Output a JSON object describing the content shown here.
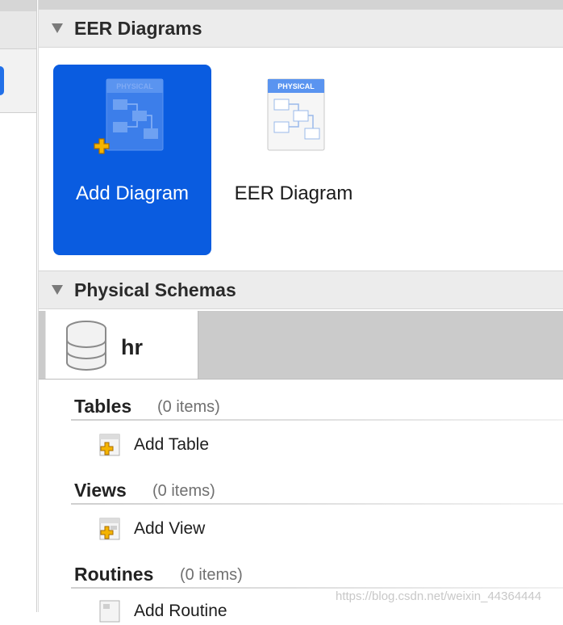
{
  "eer_section": {
    "title": "EER Diagrams"
  },
  "diagram_tiles": [
    {
      "label": "Add Diagram",
      "badge": "PHYSICAL",
      "selected": true
    },
    {
      "label": "EER Diagram",
      "badge": "PHYSICAL",
      "selected": false
    }
  ],
  "physical_section": {
    "title": "Physical Schemas"
  },
  "schema_tab": {
    "name": "hr"
  },
  "groups": [
    {
      "title": "Tables",
      "count": "(0 items)",
      "add_label": "Add Table"
    },
    {
      "title": "Views",
      "count": "(0 items)",
      "add_label": "Add View"
    },
    {
      "title": "Routines",
      "count": "(0 items)",
      "add_label": "Add Routine"
    }
  ],
  "watermark": "https://blog.csdn.net/weixin_44364444",
  "colors": {
    "selection": "#0a5ce0",
    "accent": "#2270e8",
    "add_badge": "#f4b400"
  }
}
